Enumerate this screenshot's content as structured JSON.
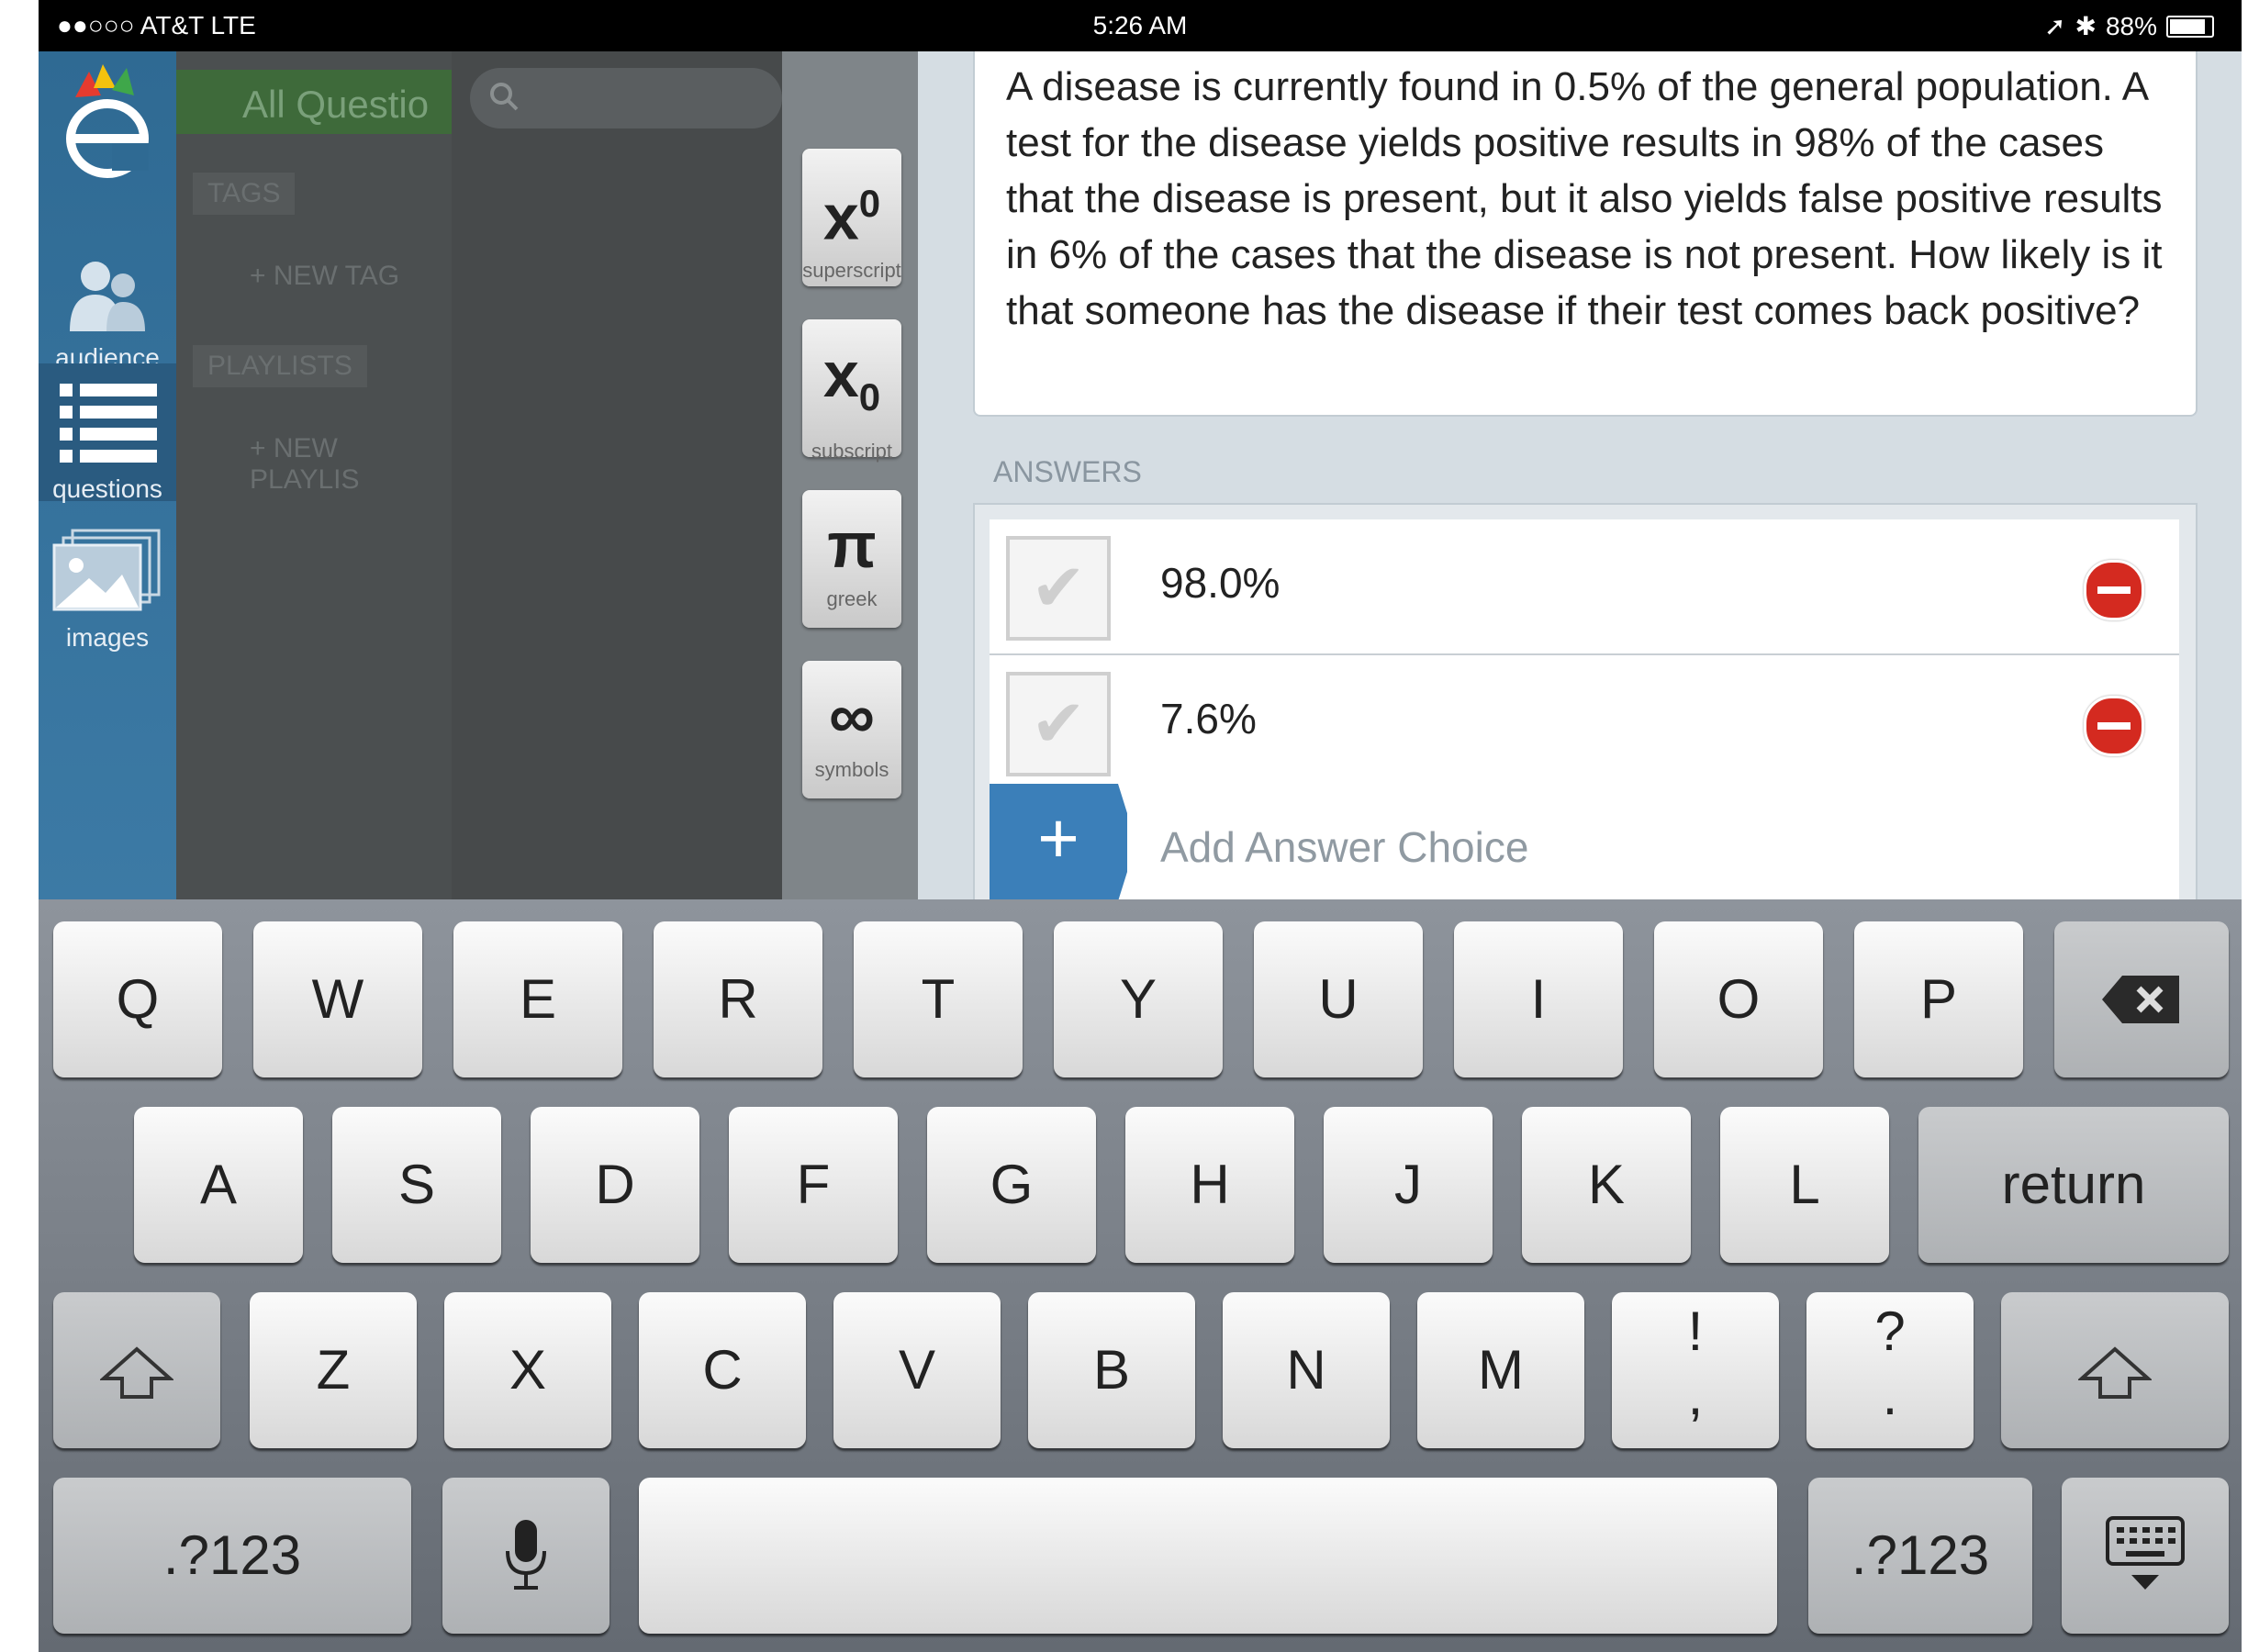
{
  "statusbar": {
    "carrier": "●●○○○ AT&T  LTE",
    "time": "5:26 AM",
    "battery": "88%"
  },
  "sidebar": {
    "items": [
      {
        "label": "audience",
        "icon": "audience-icon"
      },
      {
        "label": "questions",
        "icon": "list-icon"
      },
      {
        "label": "images",
        "icon": "images-icon"
      }
    ]
  },
  "panel": {
    "title": "All Questio",
    "tags_label": "TAGS",
    "new_tag": "+ NEW TAG",
    "playlists_label": "PLAYLISTS",
    "new_playlist": "+ NEW PLAYLIS"
  },
  "tools": [
    {
      "symbol": "x",
      "script": "0",
      "name": "superscript"
    },
    {
      "symbol": "x",
      "script": "0",
      "name": "subscript"
    },
    {
      "symbol": "π",
      "name": "greek"
    },
    {
      "symbol": "∞",
      "name": "symbols"
    }
  ],
  "question": {
    "text": "A disease is currently found in 0.5% of the general population. A test for the disease yields positive results in 98% of the cases that the disease is present, but it also yields false positive results in 6% of the cases that the disease is not present. How likely is it that someone has the disease if their test comes back positive?"
  },
  "answers": {
    "label": "ANSWERS",
    "items": [
      "98.0%",
      "7.6%"
    ],
    "add_label": "Add Answer Choice"
  },
  "keyboard": {
    "row1": [
      "Q",
      "W",
      "E",
      "R",
      "T",
      "Y",
      "U",
      "I",
      "O",
      "P"
    ],
    "row2": [
      "A",
      "S",
      "D",
      "F",
      "G",
      "H",
      "J",
      "K",
      "L"
    ],
    "return": "return",
    "row3": [
      "Z",
      "X",
      "C",
      "V",
      "B",
      "N",
      "M"
    ],
    "punct1_top": "!",
    "punct1_bottom": ",",
    "punct2_top": "?",
    "punct2_bottom": ".",
    "numbers": ".?123"
  }
}
